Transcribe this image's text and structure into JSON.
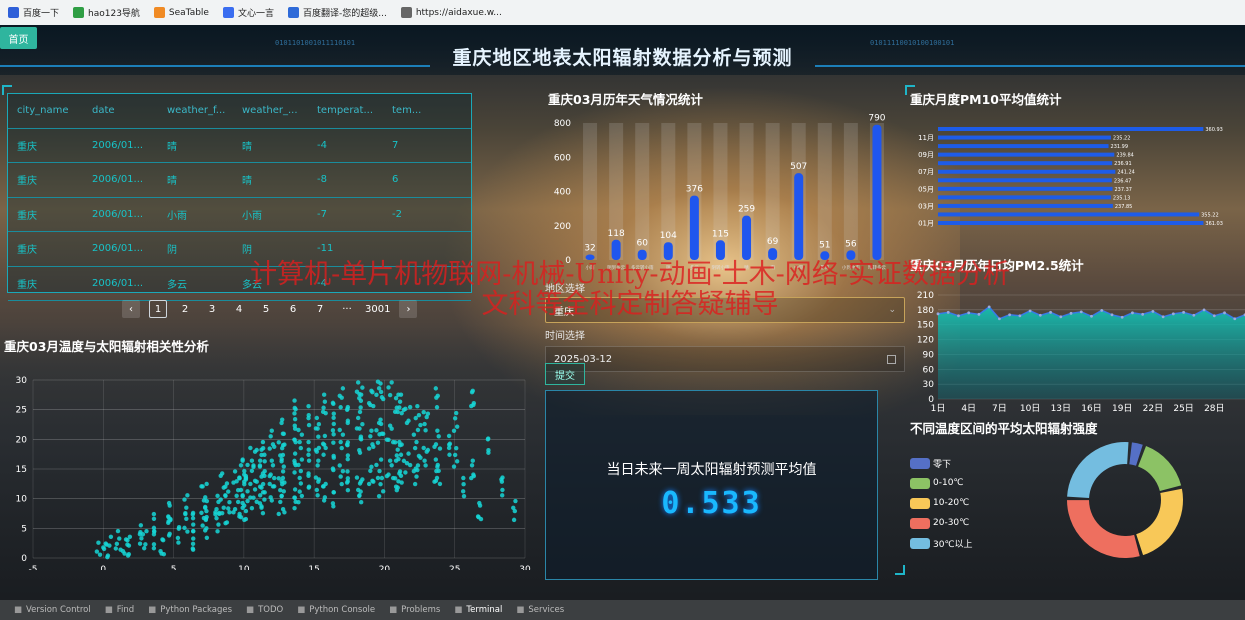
{
  "bookmarks": [
    {
      "label": "百度一下",
      "icon": "baidu-icon",
      "color": "#2e5fd8"
    },
    {
      "label": "hao123导航",
      "icon": "hao123-icon",
      "color": "#2f9e44"
    },
    {
      "label": "SeaTable",
      "icon": "seatable-icon",
      "color": "#f08a24"
    },
    {
      "label": "文心一言",
      "icon": "wenxin-icon",
      "color": "#3a6df0"
    },
    {
      "label": "百度翻译-您的超级...",
      "icon": "translate-icon",
      "color": "#2e6ad8"
    },
    {
      "label": "https://aidaxue.w...",
      "icon": "globe-icon",
      "color": "#666666"
    }
  ],
  "nav": {
    "home_label": "首页"
  },
  "header": {
    "title": "重庆地区地表太阳辐射数据分析与预测",
    "digits_left": "0101101001011110101",
    "digits_right": "01011110010100100101"
  },
  "table": {
    "columns": [
      "city_name",
      "date",
      "weather_f...",
      "weather_...",
      "temperat...",
      "tem..."
    ],
    "rows": [
      [
        "重庆",
        "2006/01...",
        "晴",
        "晴",
        "-4",
        "7"
      ],
      [
        "重庆",
        "2006/01...",
        "晴",
        "晴",
        "-8",
        "6"
      ],
      [
        "重庆",
        "2006/01...",
        "小雨",
        "小雨",
        "-7",
        "-2"
      ],
      [
        "重庆",
        "2006/01...",
        "阴",
        "阴",
        "-11",
        ""
      ],
      [
        "重庆",
        "2006/01...",
        "多云",
        "多云",
        "-4",
        ""
      ]
    ]
  },
  "pagination": {
    "prev": "‹",
    "pages": [
      "1",
      "2",
      "3",
      "4",
      "5",
      "6",
      "7"
    ],
    "ellipsis": "···",
    "last": "3001",
    "next": "›",
    "current": "1"
  },
  "watermark": {
    "line1": "计算机-单片机物联网-机械-Unity-动画-土木-网络-实证数据分析",
    "line2": "文科等全科定制答疑辅导"
  },
  "weather_chart": {
    "title": "重庆03月历年天气情况统计",
    "chart_data": {
      "type": "bar",
      "categories": [
        "小雨",
        "阴到多云",
        "多云转小雨",
        "阴",
        "多云",
        "阴转小雨",
        "晴",
        "雨",
        "中雨",
        "暴雨",
        "小到中雨",
        "晴转多云"
      ],
      "values": [
        32,
        118,
        60,
        104,
        376,
        115,
        259,
        69,
        507,
        51,
        56,
        790
      ],
      "ylim": [
        0,
        800
      ],
      "yticks": [
        0,
        200,
        400,
        600,
        800
      ]
    }
  },
  "pm10_chart": {
    "title": "重庆月度PM10平均值统计",
    "chart_data": {
      "type": "bar",
      "orientation": "horizontal",
      "categories": [
        "01月",
        "02月",
        "03月",
        "04月",
        "05月",
        "06月",
        "07月",
        "08月",
        "09月",
        "10月",
        "11月",
        "12月"
      ],
      "values": [
        361.03,
        355.22,
        237.85,
        235.13,
        237.37,
        236.47,
        241.24,
        236.91,
        239.84,
        231.99,
        235.22,
        360.93
      ],
      "ytick_labels": [
        "01月",
        "03月",
        "05月",
        "07月",
        "09月",
        "11月"
      ]
    }
  },
  "pm25_chart": {
    "title": "重庆03月历年日均PM2.5统计",
    "chart_data": {
      "type": "area",
      "x": [
        "1日",
        "2日",
        "3日",
        "4日",
        "5日",
        "6日",
        "7日",
        "8日",
        "9日",
        "10日",
        "11日",
        "12日",
        "13日",
        "14日",
        "15日",
        "16日",
        "17日",
        "18日",
        "19日",
        "20日",
        "21日",
        "22日",
        "23日",
        "24日",
        "25日",
        "26日",
        "27日",
        "28日",
        "29日",
        "30日",
        "31日"
      ],
      "values": [
        172,
        175,
        168,
        174,
        171,
        186,
        162,
        170,
        168,
        178,
        169,
        175,
        166,
        173,
        176,
        167,
        179,
        170,
        165,
        174,
        171,
        177,
        166,
        172,
        175,
        169,
        180,
        168,
        174,
        162,
        170
      ],
      "ylim": [
        0,
        210
      ],
      "yticks": [
        0,
        30,
        60,
        90,
        120,
        150,
        180,
        210
      ],
      "xticks": [
        "1日",
        "4日",
        "7日",
        "10日",
        "13日",
        "16日",
        "19日",
        "22日",
        "25日",
        "28日"
      ]
    }
  },
  "form": {
    "region_label": "地区选择",
    "region_value": "重庆",
    "date_label": "时间选择",
    "date_value": "2025-03-12",
    "submit_label": "提交"
  },
  "prediction": {
    "title": "当日未来一周太阳辐射预测平均值",
    "value": "0.533"
  },
  "scatter_chart": {
    "title": "重庆03月温度与太阳辐射相关性分析",
    "chart_data": {
      "type": "scatter",
      "xlim": [
        -5,
        30
      ],
      "ylim": [
        0,
        30
      ],
      "xticks": [
        -5,
        0,
        5,
        10,
        15,
        20,
        25,
        30
      ],
      "yticks": [
        0,
        5,
        10,
        15,
        20,
        25,
        30
      ],
      "color": "#16d6d6",
      "points": [
        [
          0,
          1
        ],
        [
          1,
          2
        ],
        [
          2,
          3
        ],
        [
          3,
          2
        ],
        [
          4,
          4
        ],
        [
          5,
          3
        ],
        [
          5,
          6
        ],
        [
          6,
          5
        ],
        [
          6,
          8
        ],
        [
          7,
          6
        ],
        [
          7,
          9
        ],
        [
          8,
          7
        ],
        [
          8,
          11
        ],
        [
          9,
          9
        ],
        [
          9,
          13
        ],
        [
          10,
          8
        ],
        [
          10,
          12
        ],
        [
          10,
          15
        ],
        [
          11,
          10
        ],
        [
          11,
          14
        ],
        [
          11,
          17
        ],
        [
          12,
          9
        ],
        [
          12,
          13
        ],
        [
          12,
          18
        ],
        [
          13,
          11
        ],
        [
          13,
          15
        ],
        [
          13,
          20
        ],
        [
          14,
          12
        ],
        [
          14,
          17
        ],
        [
          14,
          22
        ],
        [
          15,
          10
        ],
        [
          15,
          16
        ],
        [
          15,
          21
        ],
        [
          15,
          25
        ],
        [
          16,
          13
        ],
        [
          16,
          18
        ],
        [
          16,
          24
        ],
        [
          17,
          11
        ],
        [
          17,
          19
        ],
        [
          17,
          26
        ],
        [
          18,
          14
        ],
        [
          18,
          20
        ],
        [
          18,
          27
        ],
        [
          19,
          12
        ],
        [
          19,
          22
        ],
        [
          19,
          28
        ],
        [
          20,
          15
        ],
        [
          20,
          21
        ],
        [
          20,
          29
        ],
        [
          21,
          13
        ],
        [
          21,
          18
        ],
        [
          21,
          26
        ],
        [
          22,
          16
        ],
        [
          22,
          24
        ],
        [
          23,
          14
        ],
        [
          23,
          20
        ],
        [
          24,
          17
        ],
        [
          24,
          23
        ],
        [
          25,
          15
        ],
        [
          25,
          27
        ],
        [
          26,
          19
        ],
        [
          27,
          12
        ],
        [
          28,
          8
        ]
      ]
    }
  },
  "temp_donut": {
    "title": "不同温度区间的平均太阳辐射强度",
    "chart_data": {
      "type": "pie",
      "categories": [
        "零下",
        "0-10℃",
        "10-20℃",
        "20-30℃",
        "30℃以上"
      ],
      "values": [
        4,
        16,
        24,
        30,
        26
      ],
      "colors": [
        "#5570c6",
        "#8cc265",
        "#f8c858",
        "#ee6f5f",
        "#74bde0"
      ]
    }
  },
  "statusbar": [
    {
      "label": "Version Control",
      "icon": "branch-icon"
    },
    {
      "label": "Find",
      "icon": "search-icon"
    },
    {
      "label": "Python Packages",
      "icon": "packages-icon"
    },
    {
      "label": "TODO",
      "icon": "todo-icon"
    },
    {
      "label": "Python Console",
      "icon": "console-icon"
    },
    {
      "label": "Problems",
      "icon": "problems-icon"
    },
    {
      "label": "Terminal",
      "icon": "terminal-icon"
    },
    {
      "label": "Services",
      "icon": "services-icon"
    }
  ]
}
